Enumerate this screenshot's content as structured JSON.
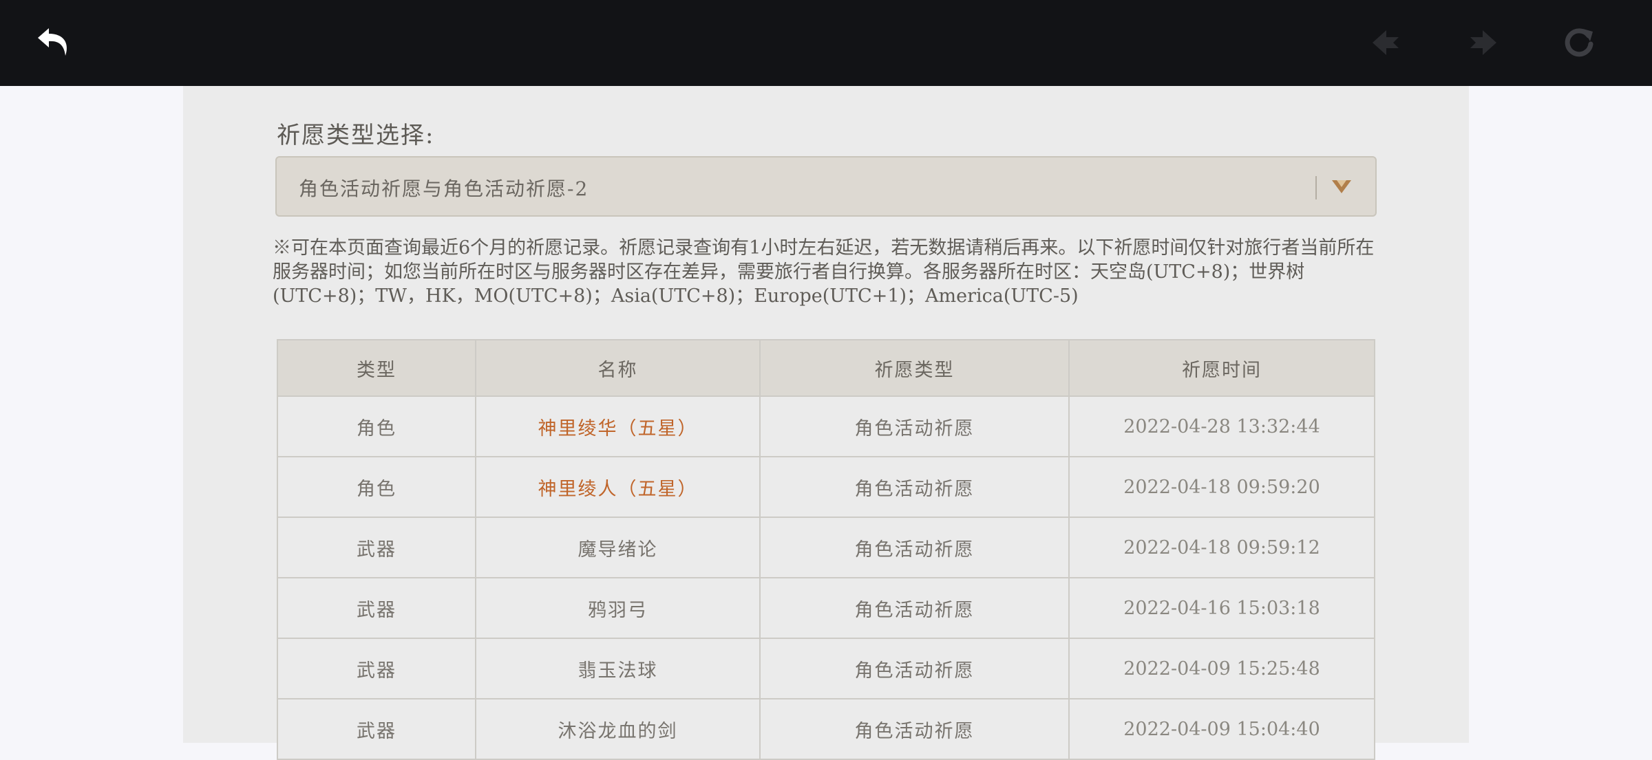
{
  "toolbar": {
    "back_icon": "back-arrow-icon",
    "prev_icon": "prev-arrow-icon",
    "next_icon": "next-arrow-icon",
    "refresh_icon": "refresh-icon"
  },
  "colors": {
    "topbar": "#121316",
    "panel": "#ebebeb",
    "five_star_name": "#c0652a",
    "dropdown_arrow": "#b17f4a"
  },
  "wish_type": {
    "label": "祈愿类型选择:",
    "selected": "角色活动祈愿与角色活动祈愿-2",
    "dropdown_icon": "chevron-down-icon"
  },
  "notice": "※可在本页面查询最近6个月的祈愿记录。祈愿记录查询有1小时左右延迟，若无数据请稍后再来。以下祈愿时间仅针对旅行者当前所在服务器时间；如您当前所在时区与服务器时区存在差异，需要旅行者自行换算。各服务器所在时区：天空岛(UTC+8)；世界树(UTC+8)；TW，HK，MO(UTC+8)；Asia(UTC+8)；Europe(UTC+1)；America(UTC-5)",
  "table": {
    "columns": [
      "类型",
      "名称",
      "祈愿类型",
      "祈愿时间"
    ],
    "rows": [
      {
        "type": "角色",
        "name": "神里绫华（五星）",
        "wish": "角色活动祈愿",
        "time": "2022-04-28 13:32:44",
        "five_star": true
      },
      {
        "type": "角色",
        "name": "神里绫人（五星）",
        "wish": "角色活动祈愿",
        "time": "2022-04-18 09:59:20",
        "five_star": true
      },
      {
        "type": "武器",
        "name": "魔导绪论",
        "wish": "角色活动祈愿",
        "time": "2022-04-18 09:59:12",
        "five_star": false
      },
      {
        "type": "武器",
        "name": "鸦羽弓",
        "wish": "角色活动祈愿",
        "time": "2022-04-16 15:03:18",
        "five_star": false
      },
      {
        "type": "武器",
        "name": "翡玉法球",
        "wish": "角色活动祈愿",
        "time": "2022-04-09 15:25:48",
        "five_star": false
      },
      {
        "type": "武器",
        "name": "沐浴龙血的剑",
        "wish": "角色活动祈愿",
        "time": "2022-04-09 15:04:40",
        "five_star": false
      }
    ]
  }
}
